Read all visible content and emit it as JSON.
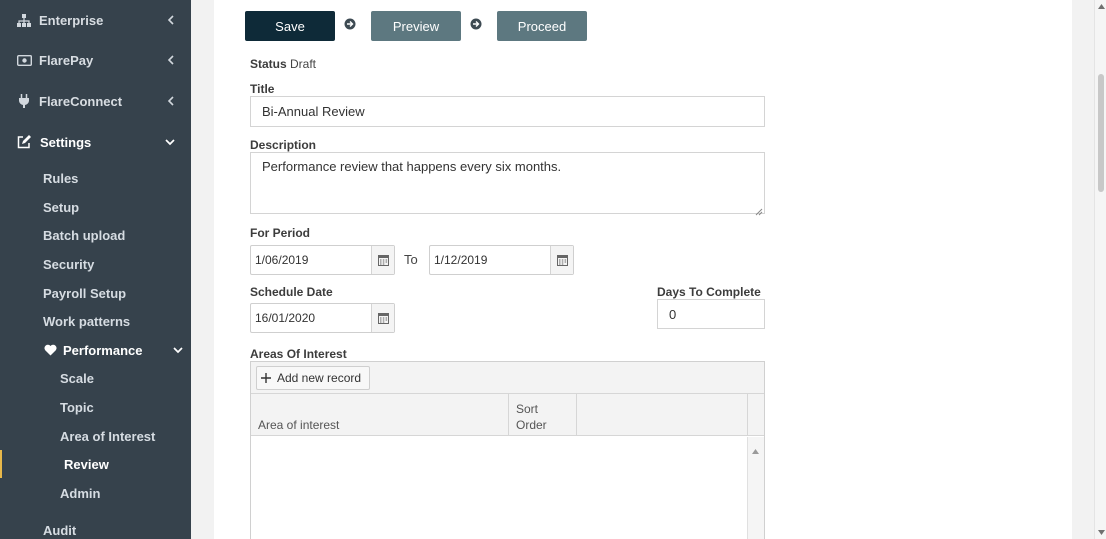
{
  "sidebar": {
    "top_items": [
      {
        "label": "Enterprise",
        "icon": "sitemap-icon"
      },
      {
        "label": "FlarePay",
        "icon": "money-icon"
      },
      {
        "label": "FlareConnect",
        "icon": "plug-icon"
      },
      {
        "label": "Settings",
        "icon": "edit-icon"
      }
    ],
    "settings_items": [
      "Rules",
      "Setup",
      "Batch upload",
      "Security",
      "Payroll Setup",
      "Work patterns"
    ],
    "performance_label": "Performance",
    "performance_items": [
      "Scale",
      "Topic",
      "Area of Interest",
      "Review",
      "Admin"
    ],
    "audit_label": "Audit"
  },
  "toolbar": {
    "save_label": "Save",
    "preview_label": "Preview",
    "proceed_label": "Proceed"
  },
  "form": {
    "status_label": "Status",
    "status_value": "Draft",
    "title_label": "Title",
    "title_value": "Bi-Annual Review",
    "description_label": "Description",
    "description_value": "Performance review that happens every six months.",
    "period_label": "For Period",
    "period_from": "1/06/2019",
    "to_label": "To",
    "period_to": "1/12/2019",
    "schedule_label": "Schedule Date",
    "schedule_value": "16/01/2020",
    "days_label": "Days To Complete",
    "days_value": "0",
    "areas_label": "Areas Of Interest"
  },
  "grid": {
    "add_label": "Add new record",
    "col_area": "Area of interest",
    "col_sort_1": "Sort",
    "col_sort_2": "Order"
  },
  "colors": {
    "sidebar_bg": "#36424c",
    "save_bg": "#0e2a38",
    "step_bg": "#5d7880",
    "active_marker": "#e8b84a"
  }
}
